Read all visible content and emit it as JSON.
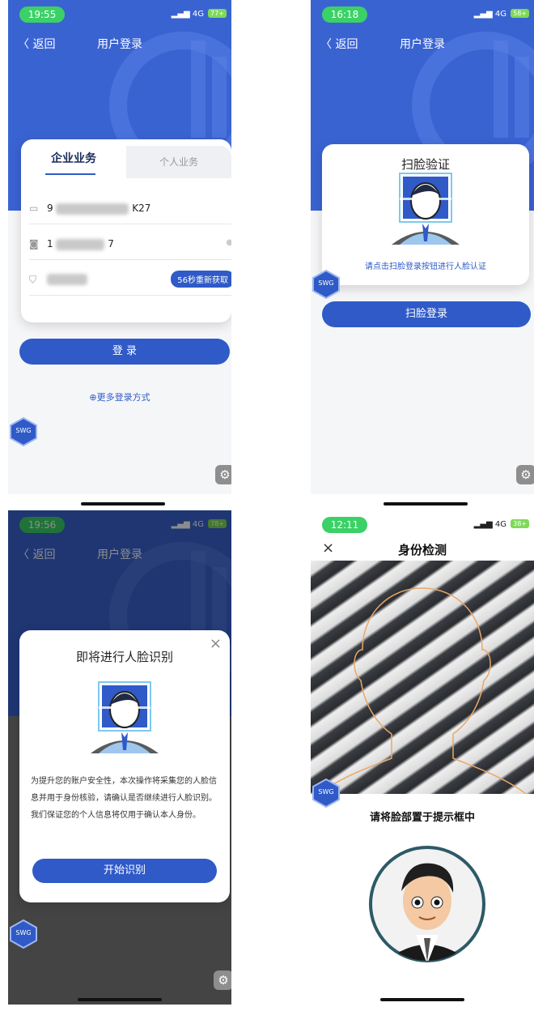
{
  "shared": {
    "back_label": "返回",
    "title": "用户登录",
    "network": "4G",
    "brand_badge": "SWG",
    "settings_icon": "gear-icon"
  },
  "screen1": {
    "time": "19:55",
    "battery": "77+",
    "tab_company": "企业业务",
    "tab_personal": "个人业务",
    "field1_prefix": "9",
    "field1_suffix": "K27",
    "field2_prefix": "1",
    "field2_suffix": "7",
    "sms_button": "56秒重新获取",
    "login_button": "登 录",
    "more_login": "⊕更多登录方式"
  },
  "screen2": {
    "time": "16:18",
    "battery": "58+",
    "card_title": "扫脸验证",
    "hint": "请点击扫脸登录按钮进行人脸认证",
    "scan_button": "扫脸登录"
  },
  "screen3": {
    "time": "19:56",
    "battery": "78+",
    "dialog_title": "即将进行人脸识别",
    "close_icon": "×",
    "body": "为提升您的账户安全性，本次操作将采集您的人脸信息并用于身份核验，请确认是否继续进行人脸识别。我们保证您的个人信息将仅用于确认本人身份。",
    "start_button": "开始识别"
  },
  "screen4": {
    "time": "12:11",
    "battery": "38+",
    "close_icon": "×",
    "title": "身份检测",
    "instruction": "请将脸部置于提示框中"
  },
  "colors": {
    "primary": "#3a63d2",
    "button": "#2f5ac7",
    "status_green": "#3bd167"
  }
}
